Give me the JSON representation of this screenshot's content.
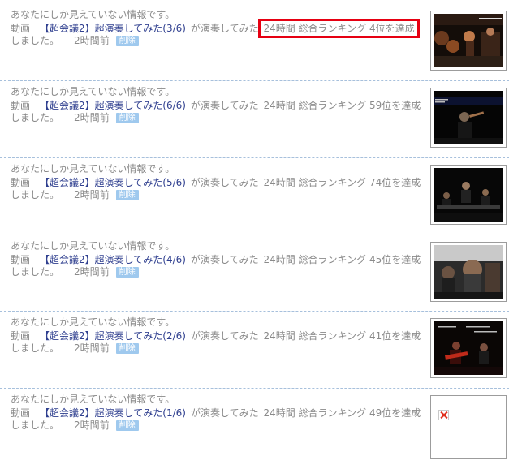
{
  "entries": [
    {
      "notice": "あなたにしか見えていない情報です。",
      "type_label": "動画",
      "title": "【超会議2】超演奏してみた(3/6)",
      "verb": "が演奏してみた",
      "ranking": "24時間 総合ランキング 4位を達成",
      "ending": "しました。",
      "time": "2時間前",
      "delete_label": "削除",
      "highlighted": true,
      "thumb": "image"
    },
    {
      "notice": "あなたにしか見えていない情報です。",
      "type_label": "動画",
      "title": "【超会議2】超演奏してみた(6/6)",
      "verb": "が演奏してみた",
      "ranking": "24時間 総合ランキング 59位を達成",
      "ending": "しました。",
      "time": "2時間前",
      "delete_label": "削除",
      "highlighted": false,
      "thumb": "image"
    },
    {
      "notice": "あなたにしか見えていない情報です。",
      "type_label": "動画",
      "title": "【超会議2】超演奏してみた(5/6)",
      "verb": "が演奏してみた",
      "ranking": "24時間 総合ランキング 74位を達成",
      "ending": "しました。",
      "time": "2時間前",
      "delete_label": "削除",
      "highlighted": false,
      "thumb": "image"
    },
    {
      "notice": "あなたにしか見えていない情報です。",
      "type_label": "動画",
      "title": "【超会議2】超演奏してみた(4/6)",
      "verb": "が演奏してみた",
      "ranking": "24時間 総合ランキング 45位を達成",
      "ending": "しました。",
      "time": "2時間前",
      "delete_label": "削除",
      "highlighted": false,
      "thumb": "image"
    },
    {
      "notice": "あなたにしか見えていない情報です。",
      "type_label": "動画",
      "title": "【超会議2】超演奏してみた(2/6)",
      "verb": "が演奏してみた",
      "ranking": "24時間 総合ランキング 41位を達成",
      "ending": "しました。",
      "time": "2時間前",
      "delete_label": "削除",
      "highlighted": false,
      "thumb": "image"
    },
    {
      "notice": "あなたにしか見えていない情報です。",
      "type_label": "動画",
      "title": "【超会議2】超演奏してみた(1/6)",
      "verb": "が演奏してみた",
      "ranking": "24時間 総合ランキング 49位を達成",
      "ending": "しました。",
      "time": "2時間前",
      "delete_label": "削除",
      "highlighted": false,
      "thumb": "broken-image"
    }
  ],
  "colors": {
    "link": "#2f3f8f",
    "text": "#8a8a8a",
    "highlight": "#e60012",
    "delete_bg": "#9fc9ee",
    "separator": "#a7c0dc"
  }
}
